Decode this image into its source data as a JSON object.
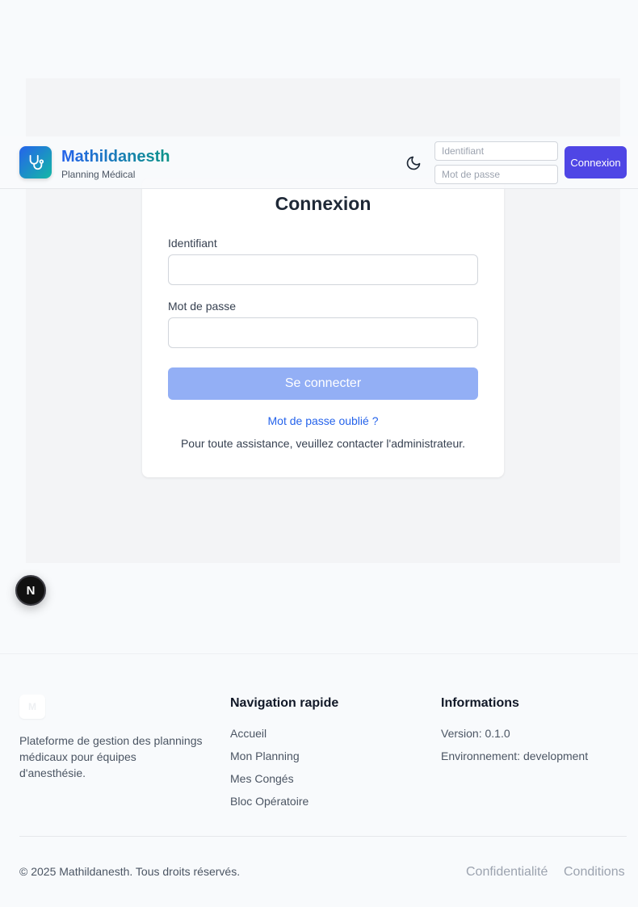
{
  "header": {
    "brand_name": "Mathildanesth",
    "brand_subtitle": "Planning Médical",
    "username_placeholder": "Identifiant",
    "password_placeholder": "Mot de passe",
    "login_button": "Connexion",
    "theme_icon": "moon-icon",
    "logo_icon": "stethoscope-icon",
    "colors": {
      "brand_gradient_start": "#2563eb",
      "brand_gradient_end": "#14b8a6",
      "login_button_bg": "#4f46e5"
    }
  },
  "login_card": {
    "title": "Connexion",
    "username_label": "Identifiant",
    "username_value": "",
    "password_label": "Mot de passe",
    "password_value": "",
    "submit_label": "Se connecter",
    "forgot_password": "Mot de passe oublié ?",
    "assistance_text": "Pour toute assistance, veuillez contacter l'administrateur.",
    "colors": {
      "submit_bg": "#93aff5",
      "link": "#2563eb"
    }
  },
  "dev_badge": {
    "letter": "N"
  },
  "footer": {
    "logo_letter": "M",
    "description": "Plateforme de gestion des plannings médicaux pour équipes d'anesthésie.",
    "nav_heading": "Navigation rapide",
    "nav_links": [
      "Accueil",
      "Mon Planning",
      "Mes Congés",
      "Bloc Opératoire"
    ],
    "info_heading": "Informations",
    "version": "Version: 0.1.0",
    "environment": "Environnement: development",
    "copyright": "© 2025 Mathildanesth. Tous droits réservés.",
    "privacy": "Confidentialité",
    "terms": "Conditions"
  }
}
